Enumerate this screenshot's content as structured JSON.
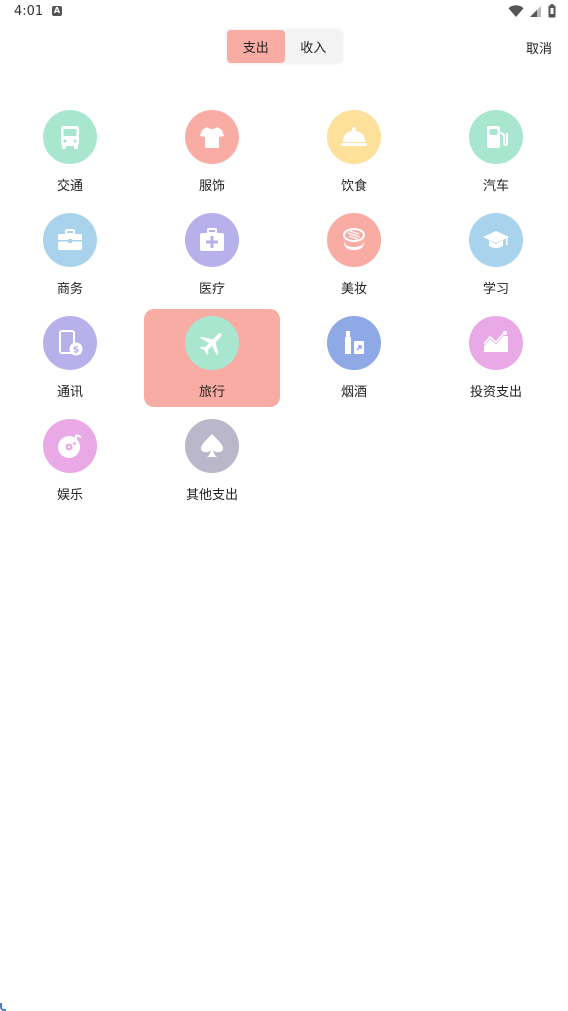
{
  "status_bar": {
    "time": "4:01",
    "notification_icon": "A"
  },
  "header": {
    "tabs": [
      {
        "label": "支出",
        "active": true
      },
      {
        "label": "收入",
        "active": false
      }
    ],
    "cancel_label": "取消"
  },
  "categories": [
    {
      "label": "交通",
      "icon": "bus-icon",
      "color": "#a8e6cf"
    },
    {
      "label": "服饰",
      "icon": "shirt-icon",
      "color": "#f8aca4"
    },
    {
      "label": "饮食",
      "icon": "food-cloche-icon",
      "color": "#fde09a"
    },
    {
      "label": "汽车",
      "icon": "fuel-pump-icon",
      "color": "#a8e6cf"
    },
    {
      "label": "商务",
      "icon": "briefcase-icon",
      "color": "#a9d3ec"
    },
    {
      "label": "医疗",
      "icon": "medical-kit-icon",
      "color": "#b8b0ea"
    },
    {
      "label": "美妆",
      "icon": "makeup-compact-icon",
      "color": "#f8aca4"
    },
    {
      "label": "学习",
      "icon": "graduation-cap-icon",
      "color": "#a9d3ec"
    },
    {
      "label": "通讯",
      "icon": "phone-bill-icon",
      "color": "#b8b0ea"
    },
    {
      "label": "旅行",
      "icon": "airplane-icon",
      "color": "#a8e6cf",
      "selected": true
    },
    {
      "label": "烟酒",
      "icon": "bottle-icon",
      "color": "#8fa8e6"
    },
    {
      "label": "投资支出",
      "icon": "investment-chart-icon",
      "color": "#e9a8e6"
    },
    {
      "label": "娱乐",
      "icon": "music-disc-icon",
      "color": "#e9a8e6"
    },
    {
      "label": "其他支出",
      "icon": "spade-icon",
      "color": "#b9b7c9"
    }
  ]
}
